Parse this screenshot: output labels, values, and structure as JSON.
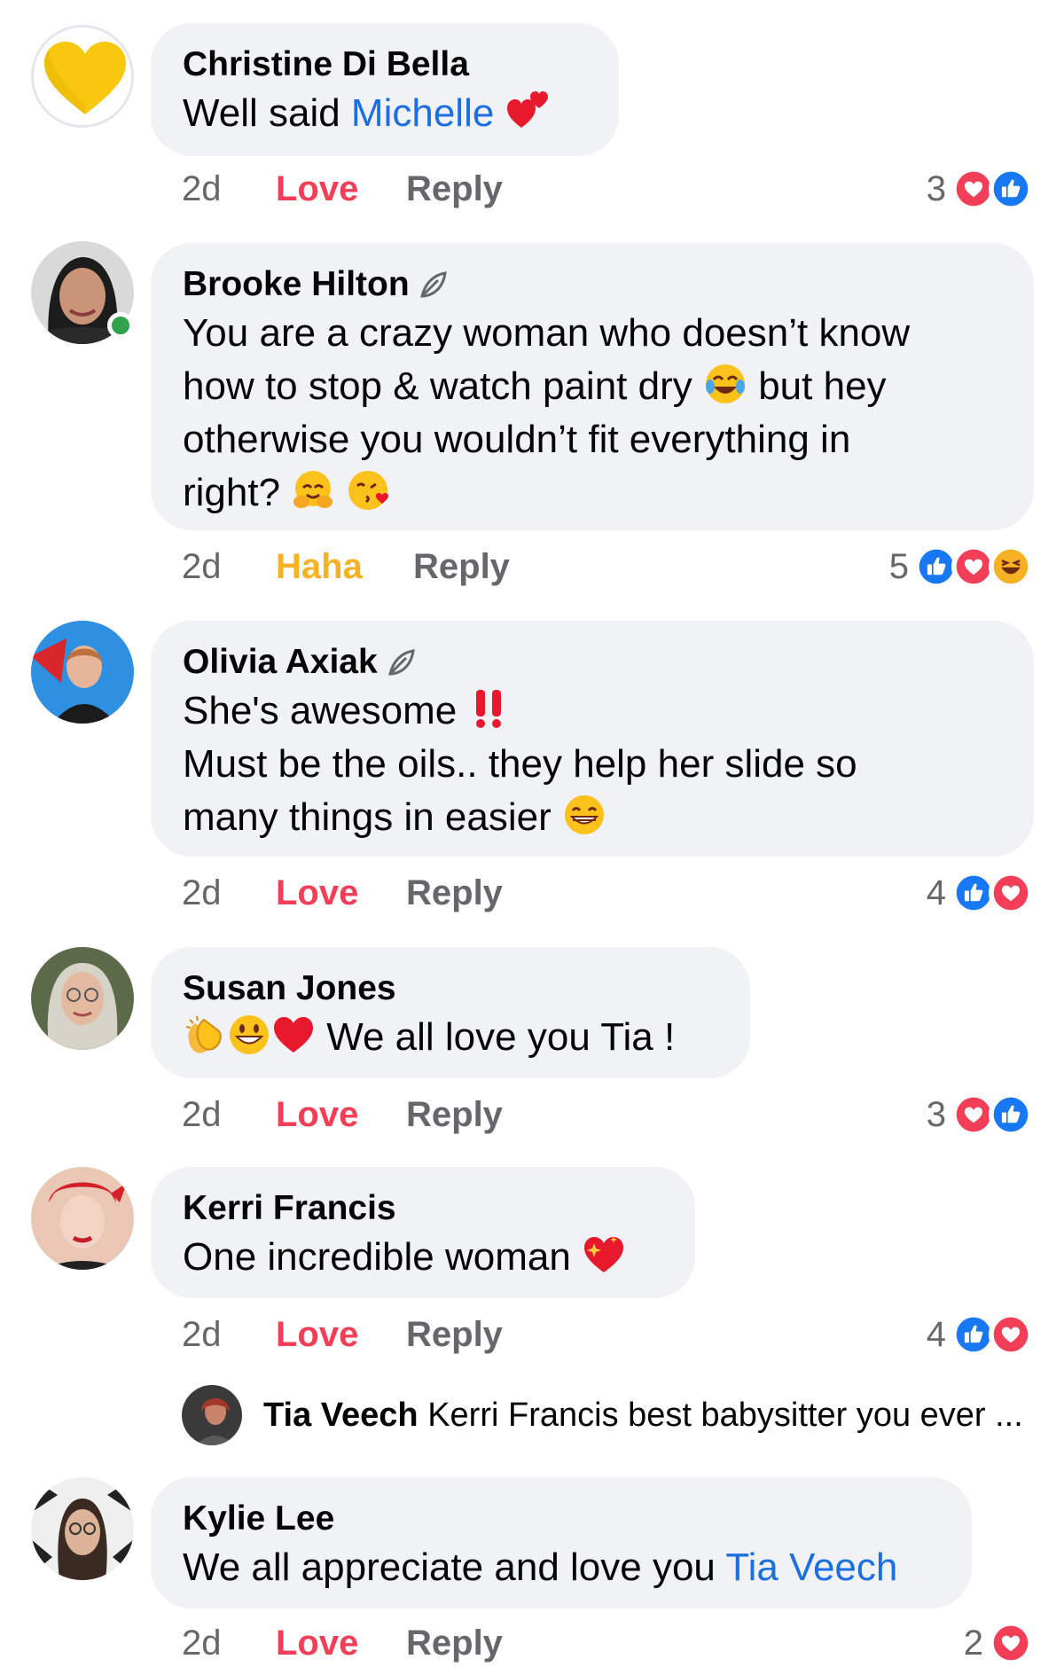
{
  "colors": {
    "bubble": "#f0f2f5",
    "love": "#f33e58",
    "haha": "#f7b125",
    "link": "#1b6fe0",
    "meta": "#65676b",
    "like": "#1877f2"
  },
  "comments": [
    {
      "author": "Christine Di Bella",
      "text_before": "Well said ",
      "mention": "Michelle",
      "emojis": [
        "two-hearts"
      ],
      "time": "2d",
      "user_reaction": "Love",
      "reply_label": "Reply",
      "reaction_count": "3",
      "reaction_icons": [
        "love",
        "like"
      ]
    },
    {
      "author": "Brooke Hilton",
      "line1": "You are a crazy woman who doesn’t know",
      "line2_before": "how to stop & watch paint dry",
      "line2_after": " but hey",
      "line3": "otherwise you wouldn’t fit everything in",
      "line4": "right?",
      "time": "2d",
      "user_reaction": "Haha",
      "reply_label": "Reply",
      "reaction_count": "5",
      "reaction_icons": [
        "like",
        "love",
        "haha"
      ]
    },
    {
      "author": "Olivia Axiak",
      "line1": "She's awesome",
      "line2": "Must be the oils.. they help her slide so",
      "line3": "many things in easier",
      "time": "2d",
      "user_reaction": "Love",
      "reply_label": "Reply",
      "reaction_count": "4",
      "reaction_icons": [
        "like",
        "love"
      ]
    },
    {
      "author": "Susan Jones",
      "text": "We all love you Tia !",
      "time": "2d",
      "user_reaction": "Love",
      "reply_label": "Reply",
      "reaction_count": "3",
      "reaction_icons": [
        "love",
        "like"
      ]
    },
    {
      "author": "Kerri Francis",
      "text": "One incredible woman",
      "time": "2d",
      "user_reaction": "Love",
      "reply_label": "Reply",
      "reaction_count": "4",
      "reaction_icons": [
        "like",
        "love"
      ]
    },
    {
      "author": "Kylie Lee",
      "text_before": "We all appreciate and love you ",
      "mention": "Tia Veech",
      "time": "2d",
      "user_reaction": "Love",
      "reply_label": "Reply",
      "reaction_count": "2",
      "reaction_icons": [
        "love"
      ]
    }
  ],
  "reply_preview": {
    "author": "Tia Veech",
    "text": "Kerri Francis best babysitter you ever ..."
  }
}
